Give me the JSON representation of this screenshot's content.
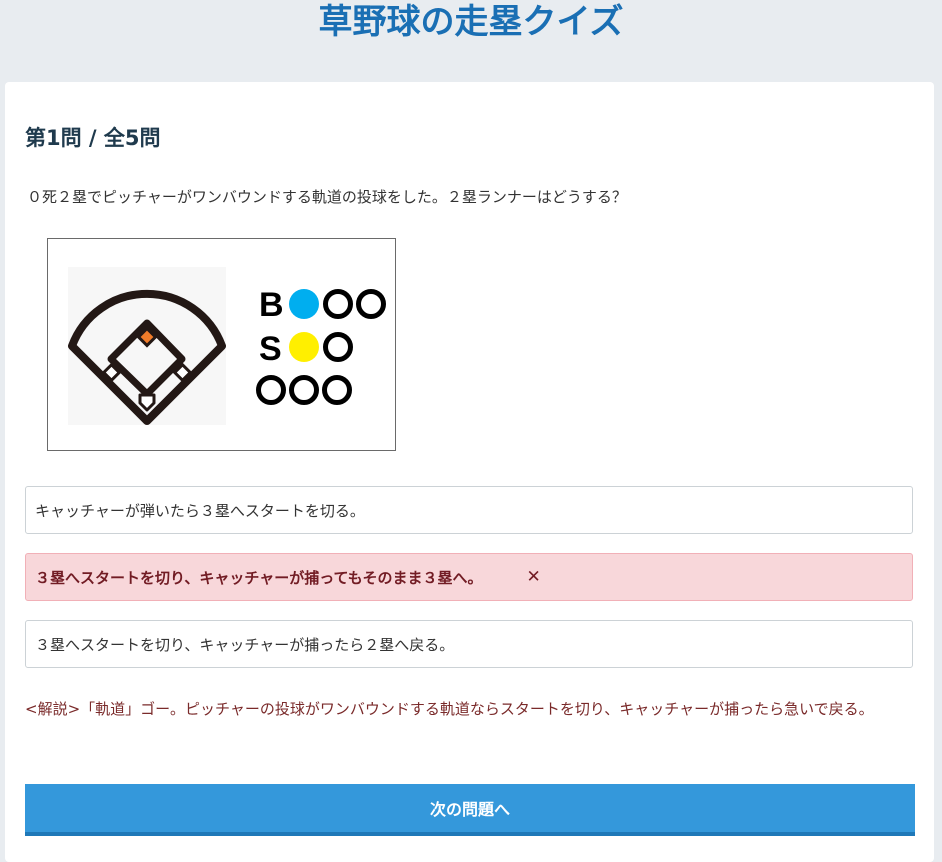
{
  "page": {
    "title": "草野球の走塁クイズ"
  },
  "quiz": {
    "counter": "第1問 / 全5問",
    "question": "０死２塁でピッチャーがワンバウンドする軌道の投球をした。２塁ランナーはどうする？",
    "diagram": {
      "field_icon": "baseball-diamond-icon",
      "occupied_base": "second",
      "runner_color": "#f07c2a",
      "count_labels": [
        "B",
        "S"
      ],
      "balls": 1,
      "strikes": 1,
      "outs": 0,
      "ball_color": "#00aeef",
      "strike_color": "#ffef00"
    },
    "options": [
      {
        "text": "キャッチャーが弾いたら３塁へスタートを切る。",
        "state": "normal"
      },
      {
        "text": "３塁へスタートを切り、キャッチャーが捕ってもそのまま３塁へ。",
        "state": "wrong",
        "mark": "✕"
      },
      {
        "text": "３塁へスタートを切り、キャッチャーが捕ったら２塁へ戻る。",
        "state": "normal"
      }
    ],
    "explanation": "<解説>「軌道」ゴー。ピッチャーの投球がワンバウンドする軌道ならスタートを切り、キャッチャーが捕ったら急いで戻る。",
    "next_label": "次の問題へ",
    "primary_color": "#3498db",
    "wrong_bg_color": "#f8d7da"
  }
}
